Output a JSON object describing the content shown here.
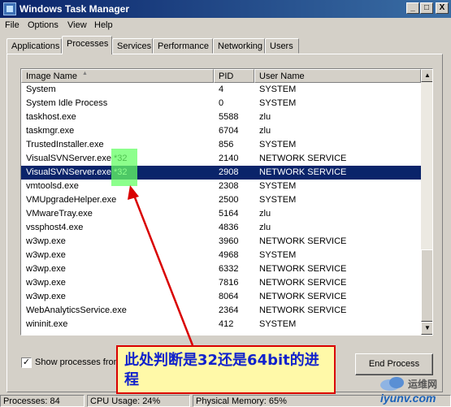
{
  "window": {
    "title": "Windows Task Manager",
    "controls": {
      "minimize": "_",
      "maximize": "□",
      "close": "X"
    }
  },
  "menu": [
    "File",
    "Options",
    "View",
    "Help"
  ],
  "tabs": [
    {
      "label": "Applications",
      "active": false
    },
    {
      "label": "Processes",
      "active": true
    },
    {
      "label": "Services",
      "active": false
    },
    {
      "label": "Performance",
      "active": false
    },
    {
      "label": "Networking",
      "active": false
    },
    {
      "label": "Users",
      "active": false
    }
  ],
  "processes": {
    "columns": [
      "Image Name",
      "PID",
      "User Name"
    ],
    "sort_icon": "▲",
    "rows": [
      {
        "name": "System",
        "pid": "4",
        "user": "SYSTEM"
      },
      {
        "name": "System Idle Process",
        "pid": "0",
        "user": "SYSTEM"
      },
      {
        "name": "taskhost.exe",
        "pid": "5588",
        "user": "zlu"
      },
      {
        "name": "taskmgr.exe",
        "pid": "6704",
        "user": "zlu"
      },
      {
        "name": "TrustedInstaller.exe",
        "pid": "856",
        "user": "SYSTEM"
      },
      {
        "name": "VisualSVNServer.exe *32",
        "pid": "2140",
        "user": "NETWORK SERVICE"
      },
      {
        "name": "VisualSVNServer.exe *32",
        "pid": "2908",
        "user": "NETWORK SERVICE"
      },
      {
        "name": "vmtoolsd.exe",
        "pid": "2308",
        "user": "SYSTEM"
      },
      {
        "name": "VMUpgradeHelper.exe",
        "pid": "2500",
        "user": "SYSTEM"
      },
      {
        "name": "VMwareTray.exe",
        "pid": "5164",
        "user": "zlu"
      },
      {
        "name": "vssphost4.exe",
        "pid": "4836",
        "user": "zlu"
      },
      {
        "name": "w3wp.exe",
        "pid": "3960",
        "user": "NETWORK SERVICE"
      },
      {
        "name": "w3wp.exe",
        "pid": "4968",
        "user": "SYSTEM"
      },
      {
        "name": "w3wp.exe",
        "pid": "6332",
        "user": "NETWORK SERVICE"
      },
      {
        "name": "w3wp.exe",
        "pid": "7816",
        "user": "NETWORK SERVICE"
      },
      {
        "name": "w3wp.exe",
        "pid": "8064",
        "user": "NETWORK SERVICE"
      },
      {
        "name": "WebAnalyticsService.exe",
        "pid": "2364",
        "user": "NETWORK SERVICE"
      },
      {
        "name": "wininit.exe",
        "pid": "412",
        "user": "SYSTEM"
      }
    ],
    "selected_index": 6
  },
  "show_all_users": {
    "label": "Show processes from",
    "checked": "✓"
  },
  "end_process_label": "End Process",
  "status": {
    "processes": "Processes: 84",
    "cpu": "CPU Usage: 24%",
    "memory": "Physical Memory: 65%"
  },
  "annotation": {
    "text": "此处判断是32还是64bit的进程",
    "highlight_color": "#66ff66",
    "arrow_color": "#d90000"
  },
  "watermark": {
    "top": "运维网",
    "bottom": "iyunv.com"
  }
}
